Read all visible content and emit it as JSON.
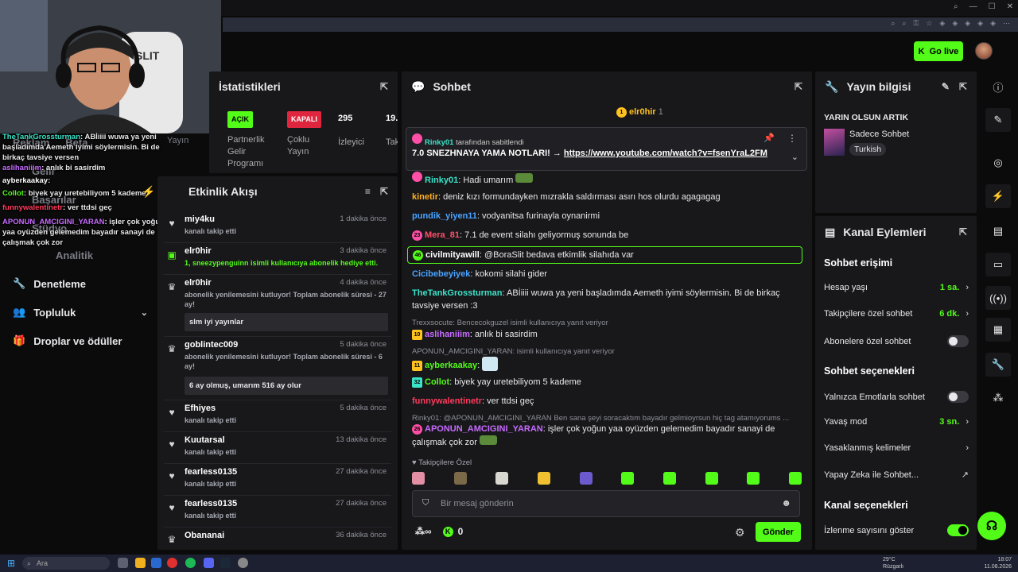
{
  "topbar": {
    "go_live": "Go live"
  },
  "overlay_chat": [
    {
      "user": "TheTankGrossturman",
      "color": "#3be3c8",
      "text": ": ABİiiii wuwa ya yeni başladımda Aemeth iyimi söylermisin. Bi de birkaç tavsiye versen"
    },
    {
      "user": "aslihaniiim",
      "color": "#c86bff",
      "text": ": anlık bi sasirdim"
    },
    {
      "user": "ayberkaakay",
      "color": "#ffffff",
      "text": ":"
    },
    {
      "user": "Collot",
      "color": "#53fc18",
      "text": ": biyek yay uretebiliyom 5 kademe"
    },
    {
      "user": "funnywalentinetr",
      "color": "#ff3b5c",
      "text": ": ver ttdsi geç"
    },
    {
      "user": "APONUN_AMCIGINI_YARAN",
      "color": "#c86bff",
      "text": ": işler çok yoğun yaa oyüzden gelemedim bayadır sanayi de çalışmak çok zor"
    }
  ],
  "sidebar": {
    "ghost_items": [
      "Reklam",
      "Beta",
      "Gelir",
      "Başarılar",
      "Stüdyo",
      "Analitik",
      "Yayın"
    ],
    "items": [
      {
        "label": "Denetleme",
        "icon": "wrench-icon"
      },
      {
        "label": "Topluluk",
        "icon": "people-icon"
      },
      {
        "label": "Droplar ve ödüller",
        "icon": "gift-icon"
      }
    ]
  },
  "stats": {
    "title": "İstatistikleri",
    "cols": [
      {
        "badge": "AÇIK",
        "badge_color": "#53fc18",
        "label": "Partnerlik Gelir Programı"
      },
      {
        "badge": "KAPALI",
        "badge_color": "#e0263e",
        "label": "Çoklu Yayın"
      },
      {
        "value": "295",
        "label": "İzleyici"
      },
      {
        "value": "19.",
        "label": "Tak"
      }
    ]
  },
  "activity": {
    "title": "Etkinlik Akışı",
    "items": [
      {
        "icon": "heart-icon",
        "name": "miy4ku",
        "time": "1 dakika önce",
        "sub": "kanalı takip etti"
      },
      {
        "icon": "gift-icon",
        "name": "elr0hir",
        "time": "3 dakika önce",
        "sub": "1, sneezypenguinn isimli kullanıcıya abonelik hediye etti.",
        "sub_color": "#53fc18"
      },
      {
        "icon": "crown-icon",
        "name": "elr0hir",
        "time": "4 dakika önce",
        "sub": "abonelik yenilemesini kutluyor! Toplam abonelik süresi - 27 ay!",
        "msg": "slm iyi yayınlar"
      },
      {
        "icon": "crown-icon",
        "name": "goblintec009",
        "time": "5 dakika önce",
        "sub": "abonelik yenilemesini kutluyor! Toplam abonelik süresi - 6 ay!",
        "msg": "6 ay olmuş, umarım 516 ay olur"
      },
      {
        "icon": "heart-icon",
        "name": "Efhiyes",
        "time": "5 dakika önce",
        "sub": "kanalı takip etti"
      },
      {
        "icon": "heart-icon",
        "name": "Kuutarsal",
        "time": "13 dakika önce",
        "sub": "kanalı takip etti"
      },
      {
        "icon": "heart-icon",
        "name": "fearless0135",
        "time": "27 dakika önce",
        "sub": "kanalı takip etti"
      },
      {
        "icon": "heart-icon",
        "name": "fearless0135",
        "time": "27 dakika önce",
        "sub": "kanalı takip etti"
      },
      {
        "icon": "crown-icon",
        "name": "Obananai",
        "time": "36 dakika önce",
        "sub": ""
      }
    ]
  },
  "chat": {
    "title": "Sohbet",
    "top_user": "elr0hir",
    "top_count": "1",
    "pinned": {
      "by_user": "Rinky01",
      "by_text": "tarafından sabitlendi",
      "text": "7.0 SNEZHNAYA YAMA NOTLARI! →",
      "link": "https://www.youtube.com/watch?v=fsenYraL2FM"
    },
    "messages": [
      {
        "badge": "",
        "user": "Rinky01",
        "color": "#3be3c8",
        "text": ": Hadi umarım"
      },
      {
        "user": "kinetir",
        "color": "#ffb020",
        "text": ": deniz kızı formundayken mızrakla saldırması asırı hos olurdu agagagag"
      },
      {
        "user": "pundik_yiyen11",
        "color": "#4aa3ff",
        "text": ": vodyanitsa furinayla oynanirmi"
      },
      {
        "badge": "23",
        "badge_color": "#ff4fa6",
        "user": "Mera_81",
        "color": "#ff4f6a",
        "text": ": 7.1 de event silahı geliyormuş sonunda be"
      },
      {
        "badge": "46",
        "badge_color": "#53fc18",
        "user": "civilmityawill",
        "color": "#ffffff",
        "text": ": @BoraSlit bedava etkimlik silahıda var",
        "highlight": true
      },
      {
        "user": "Cicibebeyiyek",
        "color": "#4aa3ff",
        "text": ": kokomi silahi gider"
      },
      {
        "user": "TheTankGrossturman",
        "color": "#3be3c8",
        "text": ": ABİiiii wuwa ya yeni başladımda Aemeth iyimi söylermisin. Bi de birkaç tavsiye versen :3"
      },
      {
        "reply": "Trexxsocute: Bencecokguzel isimli kullanıcıya yanıt veriyor",
        "badge": "10",
        "badge_color": "#ffc21f",
        "user": "aslihaniiim",
        "color": "#c86bff",
        "text": ": anlık bi sasirdim"
      },
      {
        "reply": "APONUN_AMCIGINI_YARAN: isimli kullanıcıya yanıt veriyor",
        "badge": "11",
        "badge_color": "#ffc21f",
        "user": "ayberkaakay",
        "color": "#53fc18",
        "text": ":"
      },
      {
        "badge": "32",
        "badge_color": "#3be3c8",
        "user": "Collot",
        "color": "#53fc18",
        "text": ": biyek yay uretebiliyom 5 kademe"
      },
      {
        "user": "funnywalentinetr",
        "color": "#ff3b5c",
        "text": ": ver ttdsi geç"
      },
      {
        "reply": "Rinky01: @APONUN_AMCIGINI_YARAN Ben sana şeyi soracaktım bayadır gelmioyrsun hiç tag atamıyorums ...",
        "badge": "26",
        "badge_color": "#ff4fa6",
        "user": "APONUN_AMCIGINI_YARAN",
        "color": "#c86bff",
        "text": ": işler çok yoğun yaa oyüzden gelemedim bayadır sanayi de çalışmak çok zor"
      }
    ],
    "followers_only": "Takipçilere Özel",
    "input_placeholder": "Bir mesaj gönderin",
    "send": "Gönder",
    "points": "0"
  },
  "stream_info": {
    "title": "Yayın bilgisi",
    "stream_title": "YARIN OLSUN ARTIK",
    "category": "Sadece Sohbet",
    "tag": "Turkish"
  },
  "channel_actions": {
    "title": "Kanal Eylemleri",
    "chat_access": "Sohbet erişimi",
    "rows1": [
      {
        "label": "Hesap yaşı",
        "value": "1 sa.",
        "type": "arrow"
      },
      {
        "label": "Takipçilere özel sohbet",
        "value": "6 dk.",
        "type": "arrow"
      },
      {
        "label": "Abonelere özel sohbet",
        "value": "",
        "type": "toggle",
        "on": false
      }
    ],
    "chat_options": "Sohbet seçenekleri",
    "rows2": [
      {
        "label": "Yalnızca Emotlarla sohbet",
        "value": "",
        "type": "toggle",
        "on": false
      },
      {
        "label": "Yavaş mod",
        "value": "3 sn.",
        "type": "arrow"
      },
      {
        "label": "Yasaklanmış kelimeler",
        "value": "",
        "type": "arrow"
      },
      {
        "label": "Yapay Zeka ile Sohbet...",
        "value": "",
        "type": "external"
      }
    ],
    "channel_options": "Kanal seçenekleri",
    "rows3": [
      {
        "label": "İzlenme sayısını göster",
        "value": "",
        "type": "toggle",
        "on": true
      }
    ]
  },
  "taskbar": {
    "search": "Ara",
    "weather": "29°C",
    "weather_sub": "Rüzgarlı",
    "time": "18:07",
    "date": "11.08.2026"
  }
}
